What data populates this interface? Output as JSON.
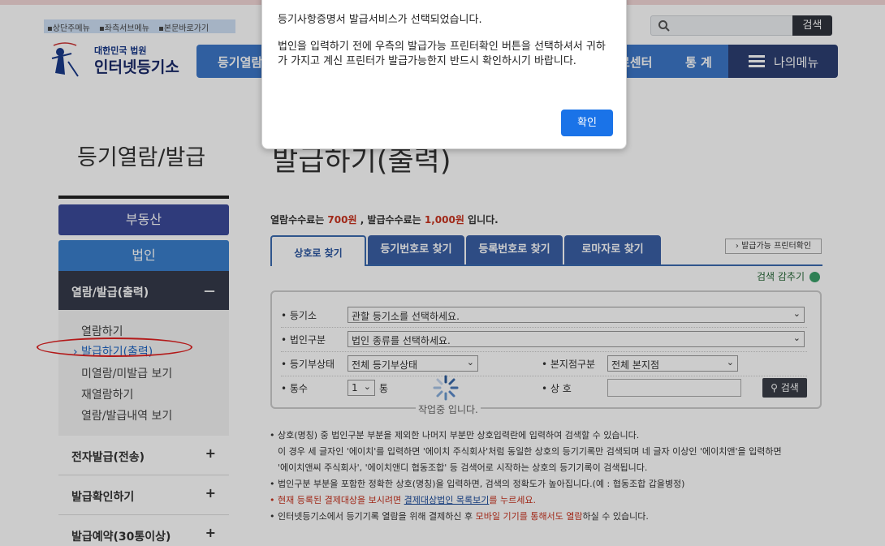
{
  "header": {
    "skip_links": [
      "상단주메뉴",
      "좌측서브메뉴",
      "본문바로가기"
    ],
    "logo_top": "대한민국 법원",
    "logo_main": "인터넷등기소",
    "search_button": "검색",
    "gnb_first": "등기열람",
    "gnb_center": "료센터",
    "gnb_stats": "통 계",
    "my_menu": "나의메뉴"
  },
  "page": {
    "side_title": "등기열람/발급",
    "title": "발급하기(출력)"
  },
  "sidebar": {
    "real_estate": "부동산",
    "corporation": "법인",
    "section": {
      "label": "열람/발급(출력)",
      "marker": "－"
    },
    "items": [
      {
        "label": "열람하기"
      },
      {
        "label": "› 발급하기(출력)"
      },
      {
        "label": "미열람/미발급 보기"
      },
      {
        "label": "재열람하기"
      },
      {
        "label": "열람/발급내역 보기"
      }
    ],
    "groups": [
      {
        "label": "전자발급(전송)",
        "marker": "+"
      },
      {
        "label": "발급확인하기",
        "marker": "+"
      },
      {
        "label": "발급예약(30통이상)",
        "marker": "+"
      }
    ]
  },
  "fee": {
    "part1": "열람수수료는 ",
    "view_fee": "700원",
    "part2": " , 발급수수료는 ",
    "issue_fee": "1,000원",
    "part3": " 입니다."
  },
  "tabs": [
    "상호로 찾기",
    "등기번호로 찾기",
    "등록번호로 찾기",
    "로마자로 찾기"
  ],
  "printer_check": "› 발급가능 프린터확인",
  "hide_search": "검색 감추기",
  "form": {
    "registry_label": "• 등기소",
    "registry_value": "관할 등기소를 선택하세요.",
    "corp_type_label": "• 법인구분",
    "corp_type_value": "법인 종류를 선택하세요.",
    "status_label": "• 등기부상태",
    "status_value": "전체 등기부상태",
    "branch_label": "• 본지점구분",
    "branch_value": "전체 본지점",
    "copies_label": "• 통수",
    "copies_value": "1",
    "copies_unit": "통",
    "name_label": "• 상 호",
    "search_button": "검색",
    "working": "작업중 입니다."
  },
  "notes": {
    "l1": "• 상호(명칭) 중 법인구분 부분을 제외한 나머지 부분만 상호입력란에 입력하여 검색할 수 있습니다.",
    "l2": "이 경우 세 글자인 '에이치'를 입력하면 '에이치 주식회사'처럼 동일한 상호의 등기기록만 검색되며 네 글자 이상인 '에이치앤'을 입력하면",
    "l3": "'에이치앤씨 주식회사', '에이치앤디 협동조합' 등 검색어로 시작하는 상호의 등기기록이 검색됩니다.",
    "l4": "• 법인구분 부분을 포함한 정확한 상호(명칭)을 입력하면, 검색의 정확도가 높아집니다.(예 : 협동조합 갑을병정)",
    "l5_a": "• 현재 등록된 결제대상을 보시려면 ",
    "l5_link": "결제대상법인 목록보기",
    "l5_b": "를 누르세요.",
    "l6_a": "• 인터넷등기소에서 등기기록 열람을 위해 결제하신 후 ",
    "l6_red": "모바일 기기를 통해서도 열람",
    "l6_b": "하실 수 있습니다."
  },
  "dialog": {
    "message1": "등기사항증명서 발급서비스가 선택되었습니다.",
    "message2": "법인을 입력하기 전에 우측의 발급가능 프린터확인 버튼을 선택하셔서 귀하가 가지고 계신 프린터가 발급가능한지 반드시 확인하시기 바랍니다.",
    "ok_button": "확인"
  },
  "colors": {
    "gnb_blue": "#3c77c8",
    "my_menu_navy": "#2c3f72",
    "fee_red": "#c8321e",
    "dialog_button": "#1a73e8"
  }
}
